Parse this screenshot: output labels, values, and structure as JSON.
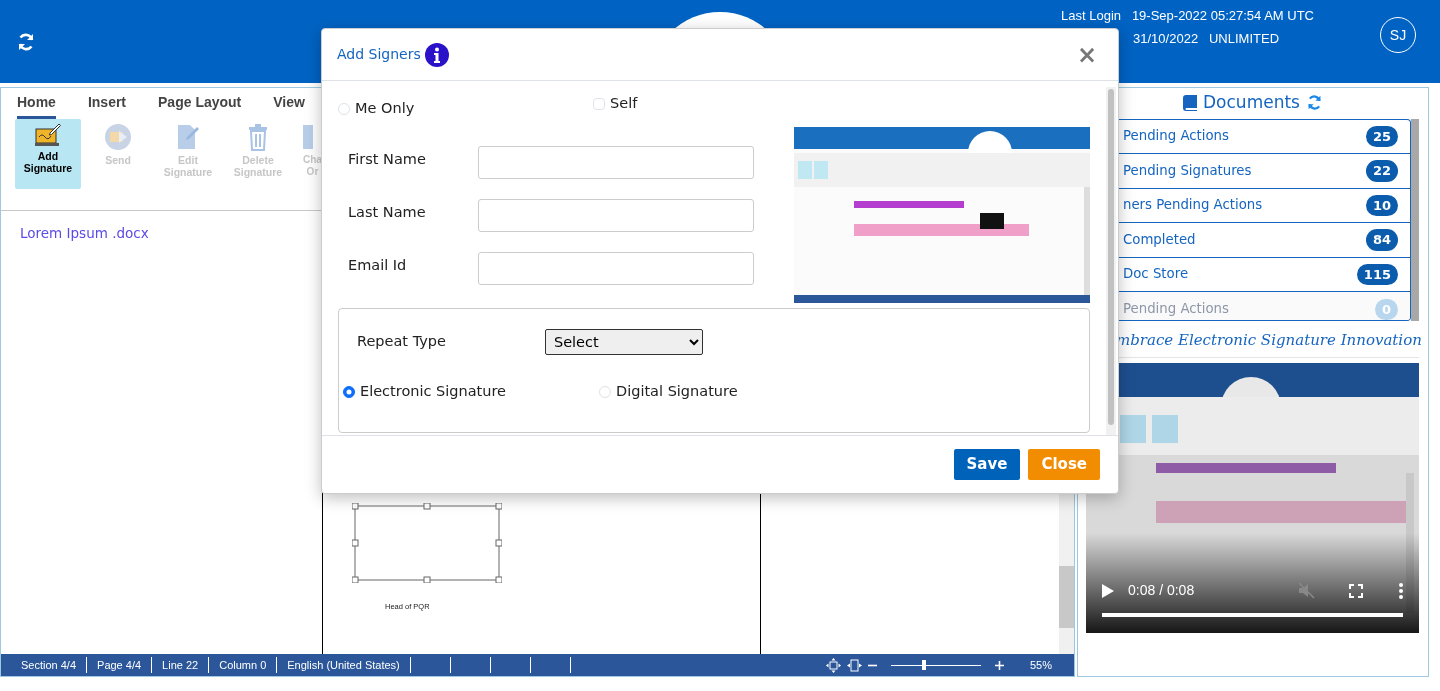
{
  "header": {
    "last_login_label": "Last Login",
    "last_login_value": "19-Sep-2022 05:27:54 AM UTC",
    "expiry_date": "31/10/2022",
    "plan": "UNLIMITED",
    "avatar": "SJ"
  },
  "ribbon": {
    "tabs": [
      {
        "label": "Home",
        "selected": true
      },
      {
        "label": "Insert",
        "selected": false
      },
      {
        "label": "Page Layout",
        "selected": false
      },
      {
        "label": "View",
        "selected": false
      }
    ],
    "tools": [
      {
        "label": "Add Signature",
        "kind": "signature",
        "selected": true,
        "disabled": false
      },
      {
        "label": "Send",
        "kind": "send",
        "selected": false,
        "disabled": true
      },
      {
        "label": "Edit Signature",
        "kind": "edit",
        "selected": false,
        "disabled": true
      },
      {
        "label": "Delete Signature",
        "kind": "delete",
        "selected": false,
        "disabled": true
      },
      {
        "label": "Cha Or",
        "kind": "order",
        "selected": false,
        "disabled": true
      }
    ]
  },
  "files": [
    {
      "name": "Lorem Ipsum .docx"
    }
  ],
  "document": {
    "caption": "Head of PQR"
  },
  "status_bar": {
    "cells": [
      "Section 4/4",
      "Page 4/4",
      "Line 22",
      "Column 0",
      "English (United States)"
    ],
    "zoom": {
      "level": 0.37,
      "reading": "55%"
    }
  },
  "documents_panel": {
    "title": "Documents",
    "items": [
      {
        "label": "Pending Actions",
        "count": "25",
        "disabled": false
      },
      {
        "label": "Pending Signatures",
        "count": "22",
        "disabled": false
      },
      {
        "label": "ners Pending Actions",
        "count": "10",
        "disabled": false
      },
      {
        "label": "Completed",
        "count": "84",
        "disabled": false
      },
      {
        "label": "Doc Store",
        "count": "115",
        "disabled": false
      },
      {
        "label": "Pending Actions",
        "count": "0",
        "disabled": true
      }
    ]
  },
  "promo": {
    "heading": "mbrace Electronic Signature Innovation"
  },
  "video": {
    "kind": "picture",
    "time": "0:08 / 0:08",
    "muted": true,
    "level": 1
  },
  "modal": {
    "title": "Add Signers",
    "close": "×",
    "me_only": {
      "label": "Me Only",
      "checked": false
    },
    "self": {
      "label": "Self",
      "checked": false
    },
    "fields": [
      {
        "label": "First Name"
      },
      {
        "label": "Last Name"
      },
      {
        "label": "Email Id"
      }
    ],
    "repeat_type": {
      "label": "Repeat Type",
      "value": "Select"
    },
    "signature_types": [
      {
        "label": "Electronic Signature",
        "selected": true
      },
      {
        "label": "Digital Signature",
        "selected": false
      }
    ],
    "buttons": [
      {
        "label": "Save",
        "kind": "primary"
      },
      {
        "label": "Close",
        "kind": "warning"
      }
    ]
  }
}
